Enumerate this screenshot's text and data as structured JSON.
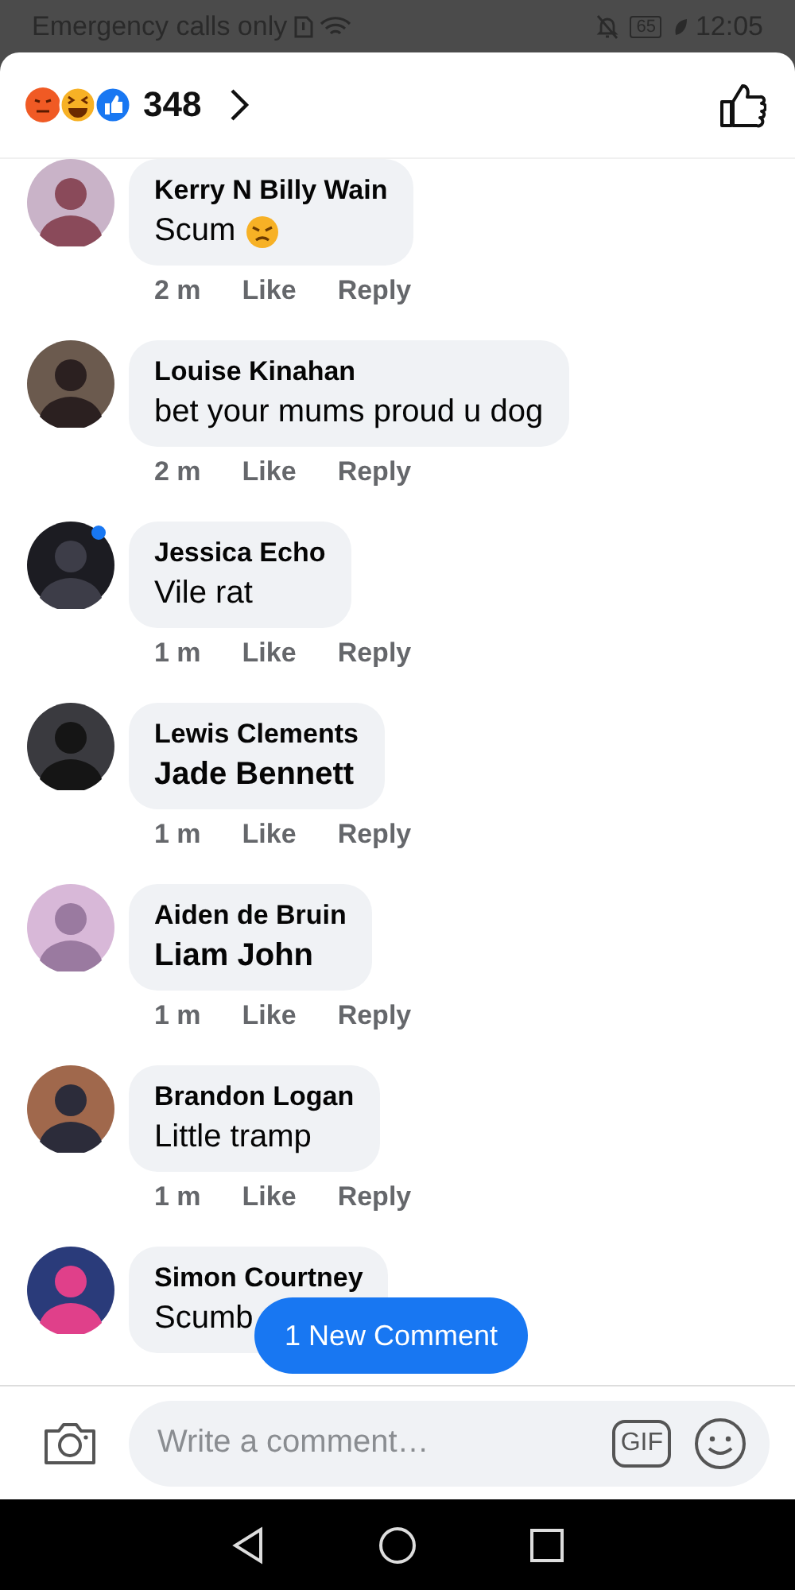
{
  "status_bar": {
    "carrier": "Emergency calls only",
    "battery": "65",
    "time": "12:05"
  },
  "header": {
    "reaction_count": "348"
  },
  "comments": [
    {
      "author": "Kerry N Billy Wain",
      "text": "Scum",
      "bold": false,
      "emoji": true,
      "online": false,
      "time": "2 m",
      "like": "Like",
      "reply": "Reply"
    },
    {
      "author": "Louise Kinahan",
      "text": "bet your mums proud u dog",
      "bold": false,
      "online": false,
      "time": "2 m",
      "like": "Like",
      "reply": "Reply"
    },
    {
      "author": "Jessica Echo",
      "text": "Vile rat",
      "bold": false,
      "online": true,
      "time": "1 m",
      "like": "Like",
      "reply": "Reply"
    },
    {
      "author": "Lewis Clements",
      "text": "Jade Bennett",
      "bold": true,
      "online": false,
      "time": "1 m",
      "like": "Like",
      "reply": "Reply"
    },
    {
      "author": "Aiden de Bruin",
      "text": "Liam John",
      "bold": true,
      "online": false,
      "time": "1 m",
      "like": "Like",
      "reply": "Reply"
    },
    {
      "author": "Brandon Logan",
      "text": "Little tramp",
      "bold": false,
      "online": false,
      "time": "1 m",
      "like": "Like",
      "reply": "Reply"
    },
    {
      "author": "Simon Courtney",
      "text": "Scumb",
      "bold": false,
      "online": false
    }
  ],
  "new_comment_button": "1 New Comment",
  "composer": {
    "placeholder": "Write a comment…",
    "gif": "GIF"
  }
}
